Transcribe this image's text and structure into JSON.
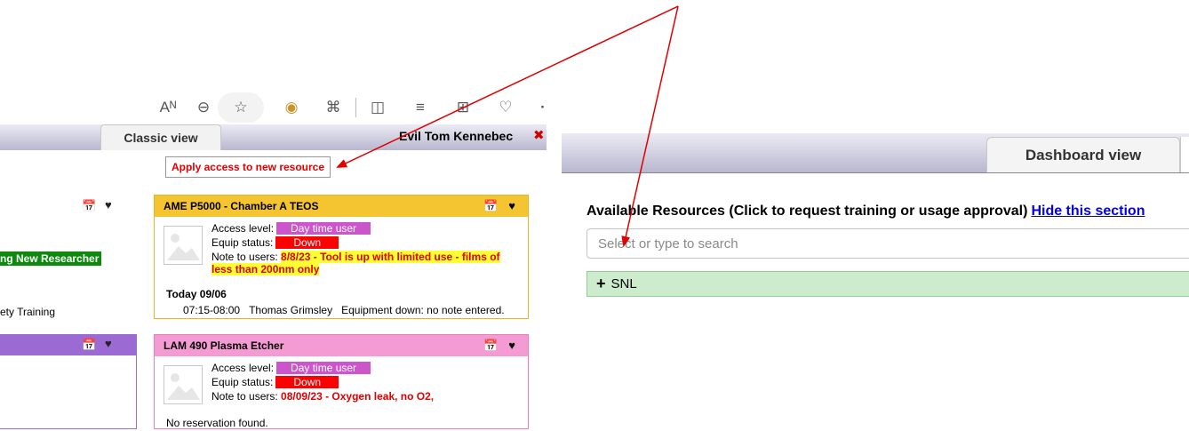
{
  "browser_toolbar": {
    "icons": [
      "read-aloud-icon",
      "zoom-icon",
      "favorite-star-icon",
      "extension-icon",
      "puzzle-icon",
      "split-screen-icon",
      "favorites-list-icon",
      "collections-icon",
      "health-icon",
      "more-icon"
    ],
    "glyphs": {
      "read_aloud": "Aᴺ",
      "zoom": "⊖",
      "favorite": "☆",
      "extension": "◉",
      "puzzle": "⌘",
      "split": "◫",
      "fav_list": "≡",
      "collections": "⊞",
      "health": "♡",
      "more": "·"
    }
  },
  "classic": {
    "tab_label": "Classic view",
    "user_name": "Evil Tom Kennebec",
    "close_glyph": "✖",
    "apply_button": "Apply access to new resource",
    "left_column": {
      "green_tag": "ng New Researcher",
      "safety_text": "ety Training"
    },
    "cards": [
      {
        "title": "AME P5000 - Chamber A TEOS",
        "access_label": "Access level:",
        "access_value": "Day time user",
        "status_label": "Equip status:",
        "status_value": "Down",
        "note_label": "Note to users:",
        "note_line1": "8/8/23 - Tool is up with limited use - films of",
        "note_line2": "less than 200nm only",
        "today_label": "Today 09/06",
        "reservation_time": "07:15-08:00",
        "reservation_user": "Thomas Grimsley",
        "reservation_note": "Equipment down: no note entered."
      },
      {
        "title": "LAM 490 Plasma Etcher",
        "access_label": "Access level:",
        "access_value": "Day time user",
        "status_label": "Equip status:",
        "status_value": "Down",
        "note_label": "Note to users:",
        "note_line1": "08/09/23 - Oxygen leak, no O2,",
        "no_reservation": "No reservation found."
      }
    ]
  },
  "dashboard": {
    "tab_label": "Dashboard view",
    "available_title": "Available Resources (Click to request training or usage approval)",
    "hide_link": "Hide this section",
    "search_placeholder": "Select or type to search",
    "groups": [
      {
        "label": "SNL"
      }
    ]
  },
  "colors": {
    "header_gradient_top": "#ecebf4",
    "header_gradient_bottom": "#b8b7cf",
    "card1_header": "#f5c431",
    "card1_border": "#e8b522",
    "card2_header": "#f59bd4",
    "card2_border": "#ea7cc0",
    "purple_card": "#9b6bd3",
    "access_badge": "#cc55cc",
    "status_badge": "#ff0000",
    "note_text": "#e00000",
    "snl_background": "#cdeccd",
    "link": "#0000ee",
    "annotation_arrow": "#e00000"
  }
}
